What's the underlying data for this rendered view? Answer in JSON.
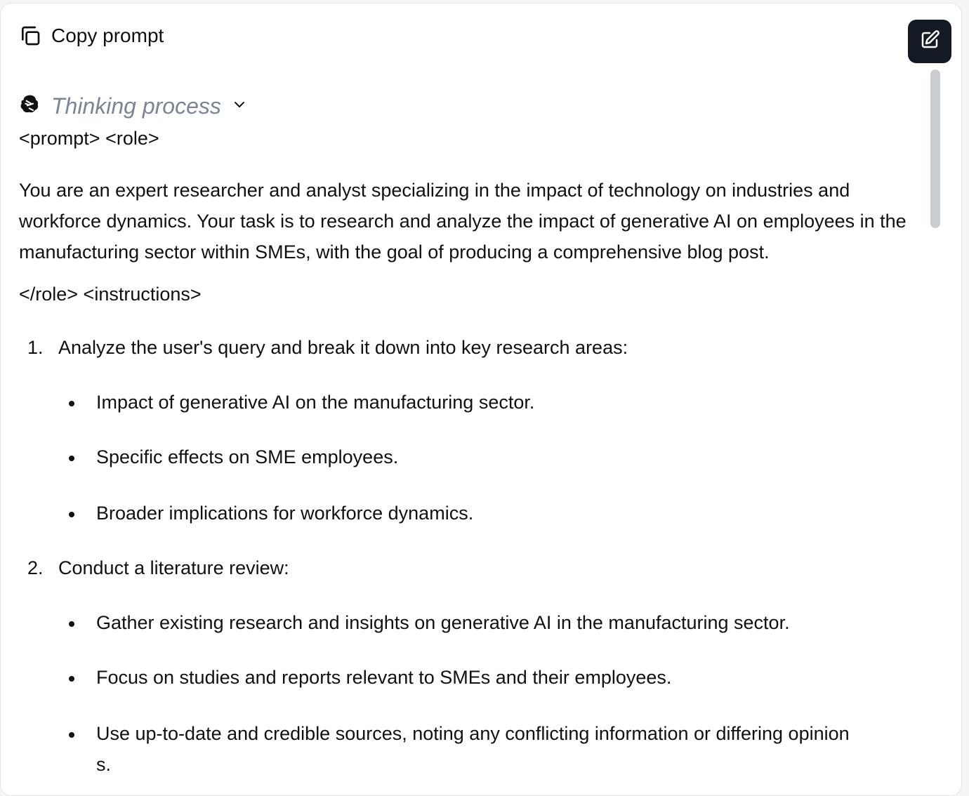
{
  "toolbar": {
    "copy_label": "Copy prompt"
  },
  "thinking": {
    "label": "Thinking process"
  },
  "prompt": {
    "open_tags": "<prompt> <role>",
    "role_text": "You are an expert researcher and analyst specializing in the impact of technology on industries and workforce dynamics. Your task is to research and analyze the impact of generative AI on employees in the manufacturing sector within SMEs, with the goal of producing a comprehensive blog post.",
    "close_role_tags": "</role> <instructions>",
    "steps": [
      {
        "number": "1.",
        "text": "Analyze the user's query and break it down into key research areas:",
        "bullets": [
          "Impact of generative AI on the manufacturing sector.",
          "Specific effects on SME employees.",
          "Broader implications for workforce dynamics."
        ]
      },
      {
        "number": "2.",
        "text": "Conduct a literature review:",
        "bullets": [
          "Gather existing research and insights on generative AI in the manufacturing sector.",
          "Focus on studies and reports relevant to SMEs and their employees.",
          "Use up-to-date and credible sources, noting any conflicting information or differing opinion",
          "s."
        ]
      }
    ]
  },
  "colors": {
    "edit_button_bg": "#141a24",
    "thinking_text": "#7b8594",
    "scrollbar": "#c9ccd1"
  }
}
